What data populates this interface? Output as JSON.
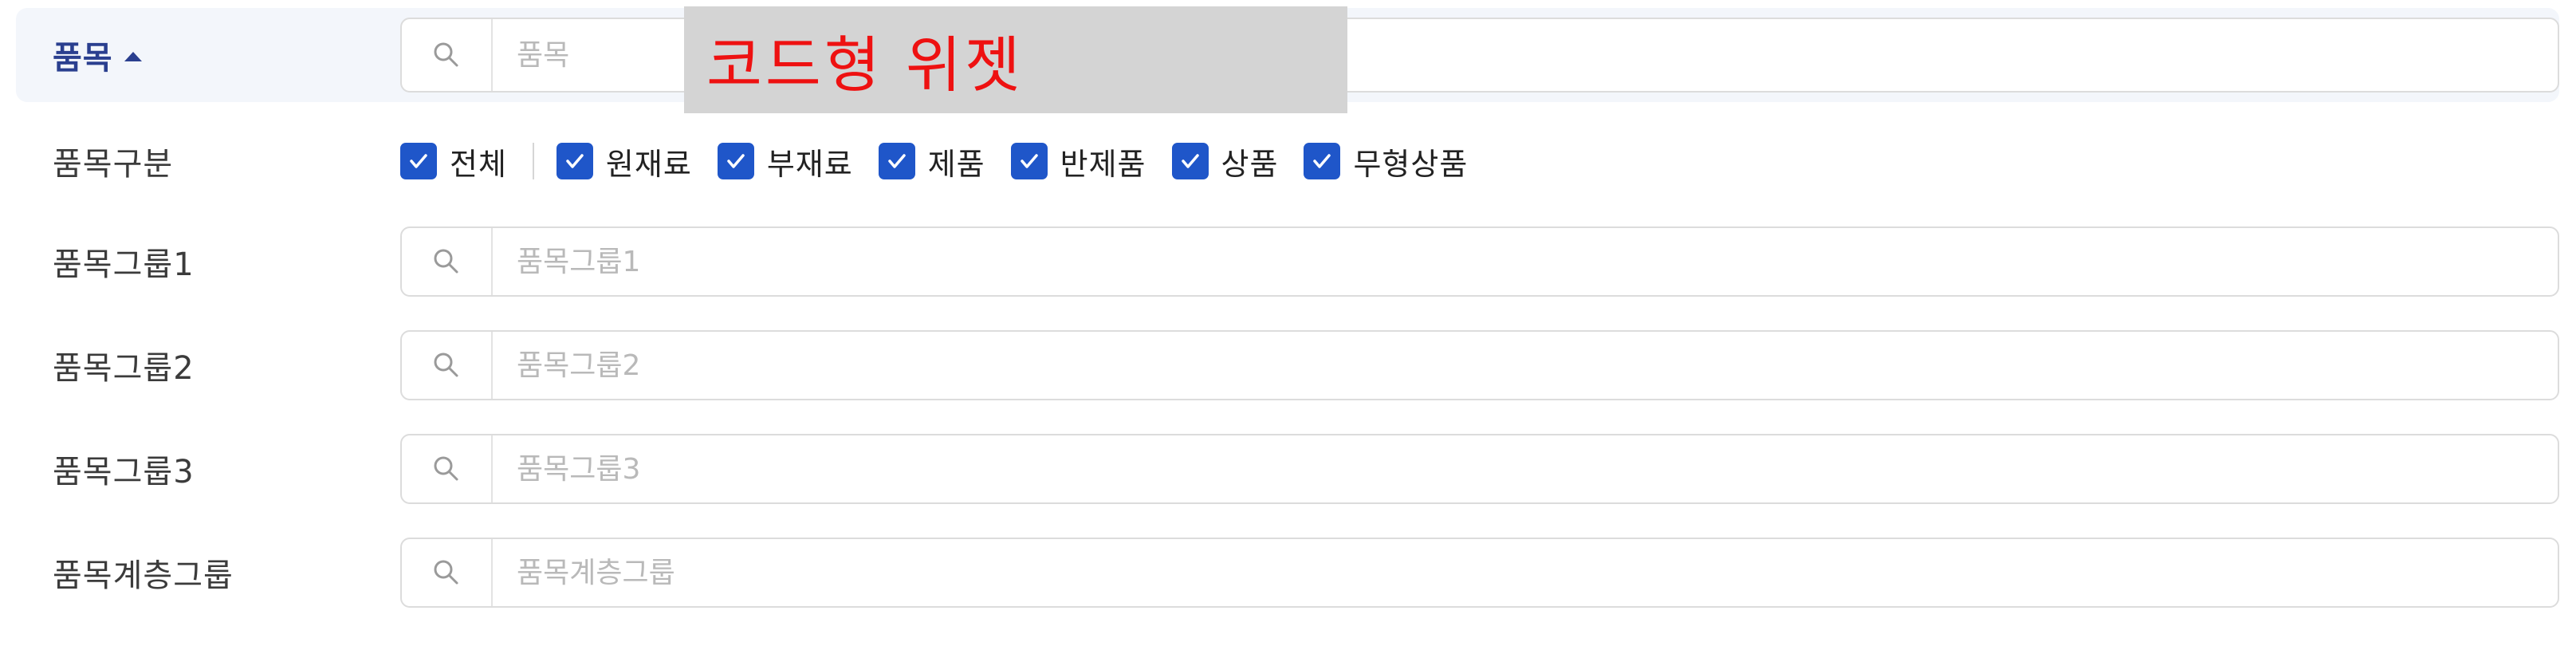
{
  "item": {
    "label": "품목",
    "placeholder": "품목"
  },
  "item_type": {
    "label": "품목구분",
    "options": [
      {
        "label": "전체",
        "checked": true
      },
      {
        "label": "원재료",
        "checked": true
      },
      {
        "label": "부재료",
        "checked": true
      },
      {
        "label": "제품",
        "checked": true
      },
      {
        "label": "반제품",
        "checked": true
      },
      {
        "label": "상품",
        "checked": true
      },
      {
        "label": "무형상품",
        "checked": true
      }
    ]
  },
  "item_group1": {
    "label": "품목그룹1",
    "placeholder": "품목그룹1"
  },
  "item_group2": {
    "label": "품목그룹2",
    "placeholder": "품목그룹2"
  },
  "item_group3": {
    "label": "품목그룹3",
    "placeholder": "품목그룹3"
  },
  "item_hierarchy_group": {
    "label": "품목계층그룹",
    "placeholder": "품목계층그룹"
  },
  "overlay": {
    "text": "코드형 위젯"
  },
  "colors": {
    "accent": "#1f56c9",
    "active_label": "#2a3f8f",
    "highlight_row": "#f3f6fb",
    "overlay_bg": "#d4d4d4",
    "overlay_text": "#ee1111"
  },
  "icons": {
    "search": "search-icon",
    "check": "check-icon",
    "caret": "caret-up-icon"
  }
}
